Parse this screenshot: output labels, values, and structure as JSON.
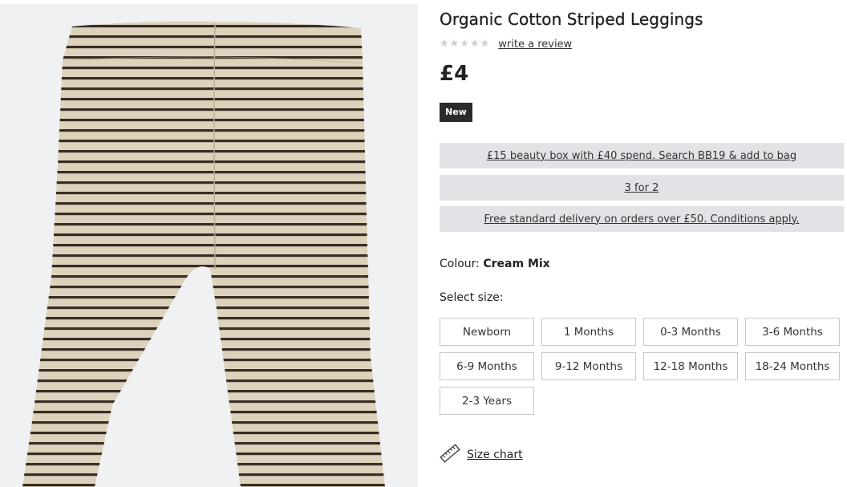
{
  "product": {
    "title": "Organic Cotton Striped Leggings",
    "review_link": "write a review",
    "rating_stars": [
      "★",
      "★",
      "★",
      "★",
      "★"
    ],
    "price": "£4",
    "badge": "New",
    "promos": [
      "£15 beauty box with £40 spend. Search BB19 & add to bag",
      "3 for 2",
      "Free standard delivery on orders over £50. Conditions apply."
    ],
    "colour_label": "Colour:",
    "colour_value": "Cream Mix",
    "size_label": "Select size:",
    "sizes": [
      "Newborn",
      "1 Months",
      "0-3 Months",
      "3-6 Months",
      "6-9 Months",
      "9-12 Months",
      "12-18 Months",
      "18-24 Months",
      "2-3 Years"
    ],
    "size_chart_label": "Size chart"
  },
  "colors": {
    "stripe_dark": "#3a2d24",
    "stripe_light": "#ddd3bd",
    "promo_bg": "#e1e3e6",
    "badge_bg": "#2b2b2b"
  },
  "icons": {
    "size_chart": "ruler-icon",
    "star": "star-icon"
  }
}
